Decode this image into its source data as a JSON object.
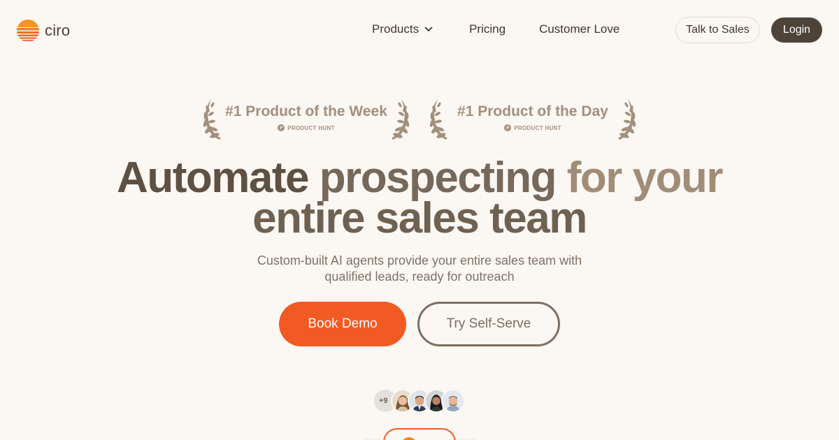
{
  "brand": {
    "name": "ciro",
    "accent": "#f25a23",
    "dark": "#4e4339"
  },
  "nav": {
    "products": "Products",
    "pricing": "Pricing",
    "customer_love": "Customer Love",
    "talk_to_sales": "Talk to Sales",
    "login": "Login"
  },
  "awards": [
    {
      "title": "#1 Product of the Week",
      "source": "PRODUCT HUNT"
    },
    {
      "title": "#1 Product of the Day",
      "source": "PRODUCT HUNT"
    }
  ],
  "hero": {
    "headline_parts": [
      "Automate ",
      "prospecting ",
      "for your",
      "entire sales team"
    ],
    "subhead": "Custom-built AI agents provide your entire sales team with qualified leads, ready for outreach",
    "cta_primary": "Book Demo",
    "cta_secondary": "Try Self-Serve"
  },
  "social_proof": {
    "count_label": "+9"
  },
  "icons": [
    "sunset-logo-icon",
    "chevron-down-icon",
    "laurel-icon",
    "product-hunt-icon"
  ]
}
